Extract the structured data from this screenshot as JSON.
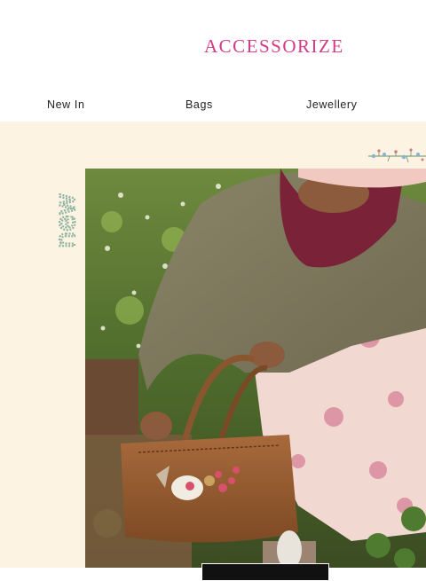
{
  "brand": {
    "logo": "ACCESSORIZE",
    "color": "#d63a86"
  },
  "nav": {
    "items": [
      {
        "label": "New In"
      },
      {
        "label": "Bags"
      },
      {
        "label": "Jewellery"
      }
    ]
  },
  "hero": {
    "vertical_word": "new",
    "vertical_word_color": "#8fb3a2",
    "background": "#fdf3e3",
    "image_description_icon": "lifestyle-photo"
  }
}
